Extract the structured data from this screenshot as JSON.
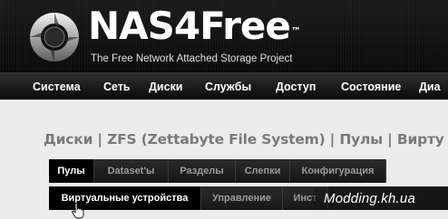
{
  "header": {
    "logo_text": "NAS4Free",
    "logo_tm": "™",
    "tagline": "The Free Network Attached Storage Project"
  },
  "menu": {
    "items": [
      {
        "label": "Система"
      },
      {
        "label": "Сеть"
      },
      {
        "label": "Диски"
      },
      {
        "label": "Службы"
      },
      {
        "label": "Доступ"
      },
      {
        "label": "Состояние"
      },
      {
        "label": "Диа"
      }
    ]
  },
  "page": {
    "title": "Диски | ZFS (Zettabyte File System) | Пулы | Вирту"
  },
  "tabs_primary": [
    {
      "label": "Пулы",
      "active": true
    },
    {
      "label": "Dataset'ы",
      "active": false
    },
    {
      "label": "Разделы",
      "active": false
    },
    {
      "label": "Слепки",
      "active": false
    },
    {
      "label": "Конфигурация",
      "active": false
    }
  ],
  "tabs_secondary": [
    {
      "label": "Виртуальные устройства",
      "active": true
    },
    {
      "label": "Управление",
      "active": false
    },
    {
      "label": "Инст",
      "active": false
    }
  ],
  "watermark": "Modding.kh.ua",
  "colors": {
    "header_bg": "#141414",
    "menu_text": "#ffffff",
    "title_text": "#7a7a7a",
    "tab_inactive_text": "#9a9a9a",
    "page_bg": "#ececec"
  }
}
